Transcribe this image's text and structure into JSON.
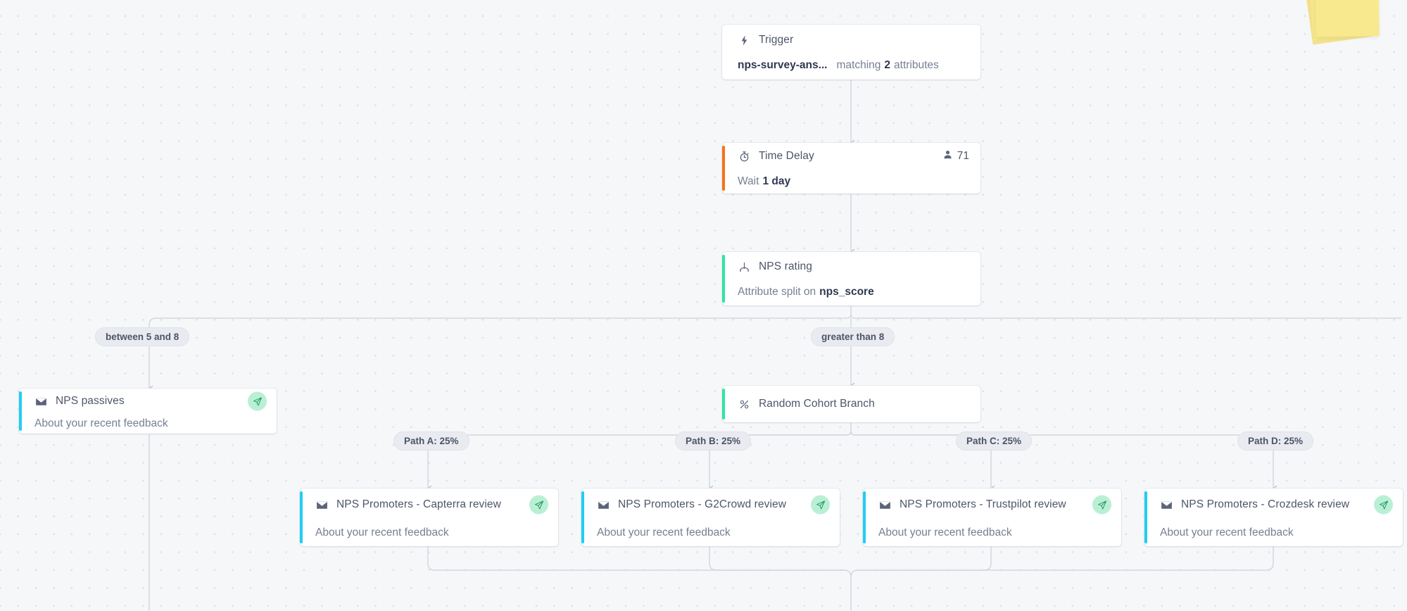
{
  "canvas": {
    "sticky_note": "sticky-note-stack"
  },
  "nodes": {
    "trigger": {
      "icon": "lightning-bolt-icon",
      "title": "Trigger",
      "event": "nps-survey-ans...",
      "detail_prefix": "matching",
      "detail_count": "2",
      "detail_suffix": "attributes",
      "accent": "#ffffff"
    },
    "time_delay": {
      "icon": "stopwatch-icon",
      "title": "Time Delay",
      "sub_prefix": "Wait",
      "sub_value": "1 day",
      "people_icon": "person-icon",
      "people_count": "71",
      "accent": "#f97316"
    },
    "nps_rating": {
      "icon": "branch-split-icon",
      "title": "NPS rating",
      "sub_prefix": "Attribute split on",
      "sub_value": "nps_score",
      "accent": "#2ee6a0"
    },
    "random_cohort": {
      "icon": "percent-icon",
      "title": "Random Cohort Branch",
      "accent": "#2ee6a0"
    },
    "nps_passives": {
      "icon": "envelope-icon",
      "title": "NPS passives",
      "subject": "About your recent feedback",
      "send_icon": "paper-plane-icon",
      "accent": "#22cdf5"
    },
    "promoter_capterra": {
      "icon": "envelope-icon",
      "title": "NPS Promoters - Capterra review",
      "subject": "About your recent feedback",
      "send_icon": "paper-plane-icon",
      "accent": "#22cdf5"
    },
    "promoter_g2crowd": {
      "icon": "envelope-icon",
      "title": "NPS Promoters - G2Crowd review",
      "subject": "About your recent feedback",
      "send_icon": "paper-plane-icon",
      "accent": "#22cdf5"
    },
    "promoter_trustpilot": {
      "icon": "envelope-icon",
      "title": "NPS Promoters - Trustpilot review",
      "subject": "About your recent feedback",
      "send_icon": "paper-plane-icon",
      "accent": "#22cdf5"
    },
    "promoter_crozdesk": {
      "icon": "envelope-icon",
      "title": "NPS Promoters - Crozdesk review",
      "subject": "About your recent feedback",
      "send_icon": "paper-plane-icon",
      "accent": "#22cdf5"
    }
  },
  "branch_labels": {
    "passives": "between 5 and 8",
    "promoters": "greater than 8",
    "path_a": "Path A: 25%",
    "path_b": "Path B: 25%",
    "path_c": "Path C: 25%",
    "path_d": "Path D: 25%"
  }
}
